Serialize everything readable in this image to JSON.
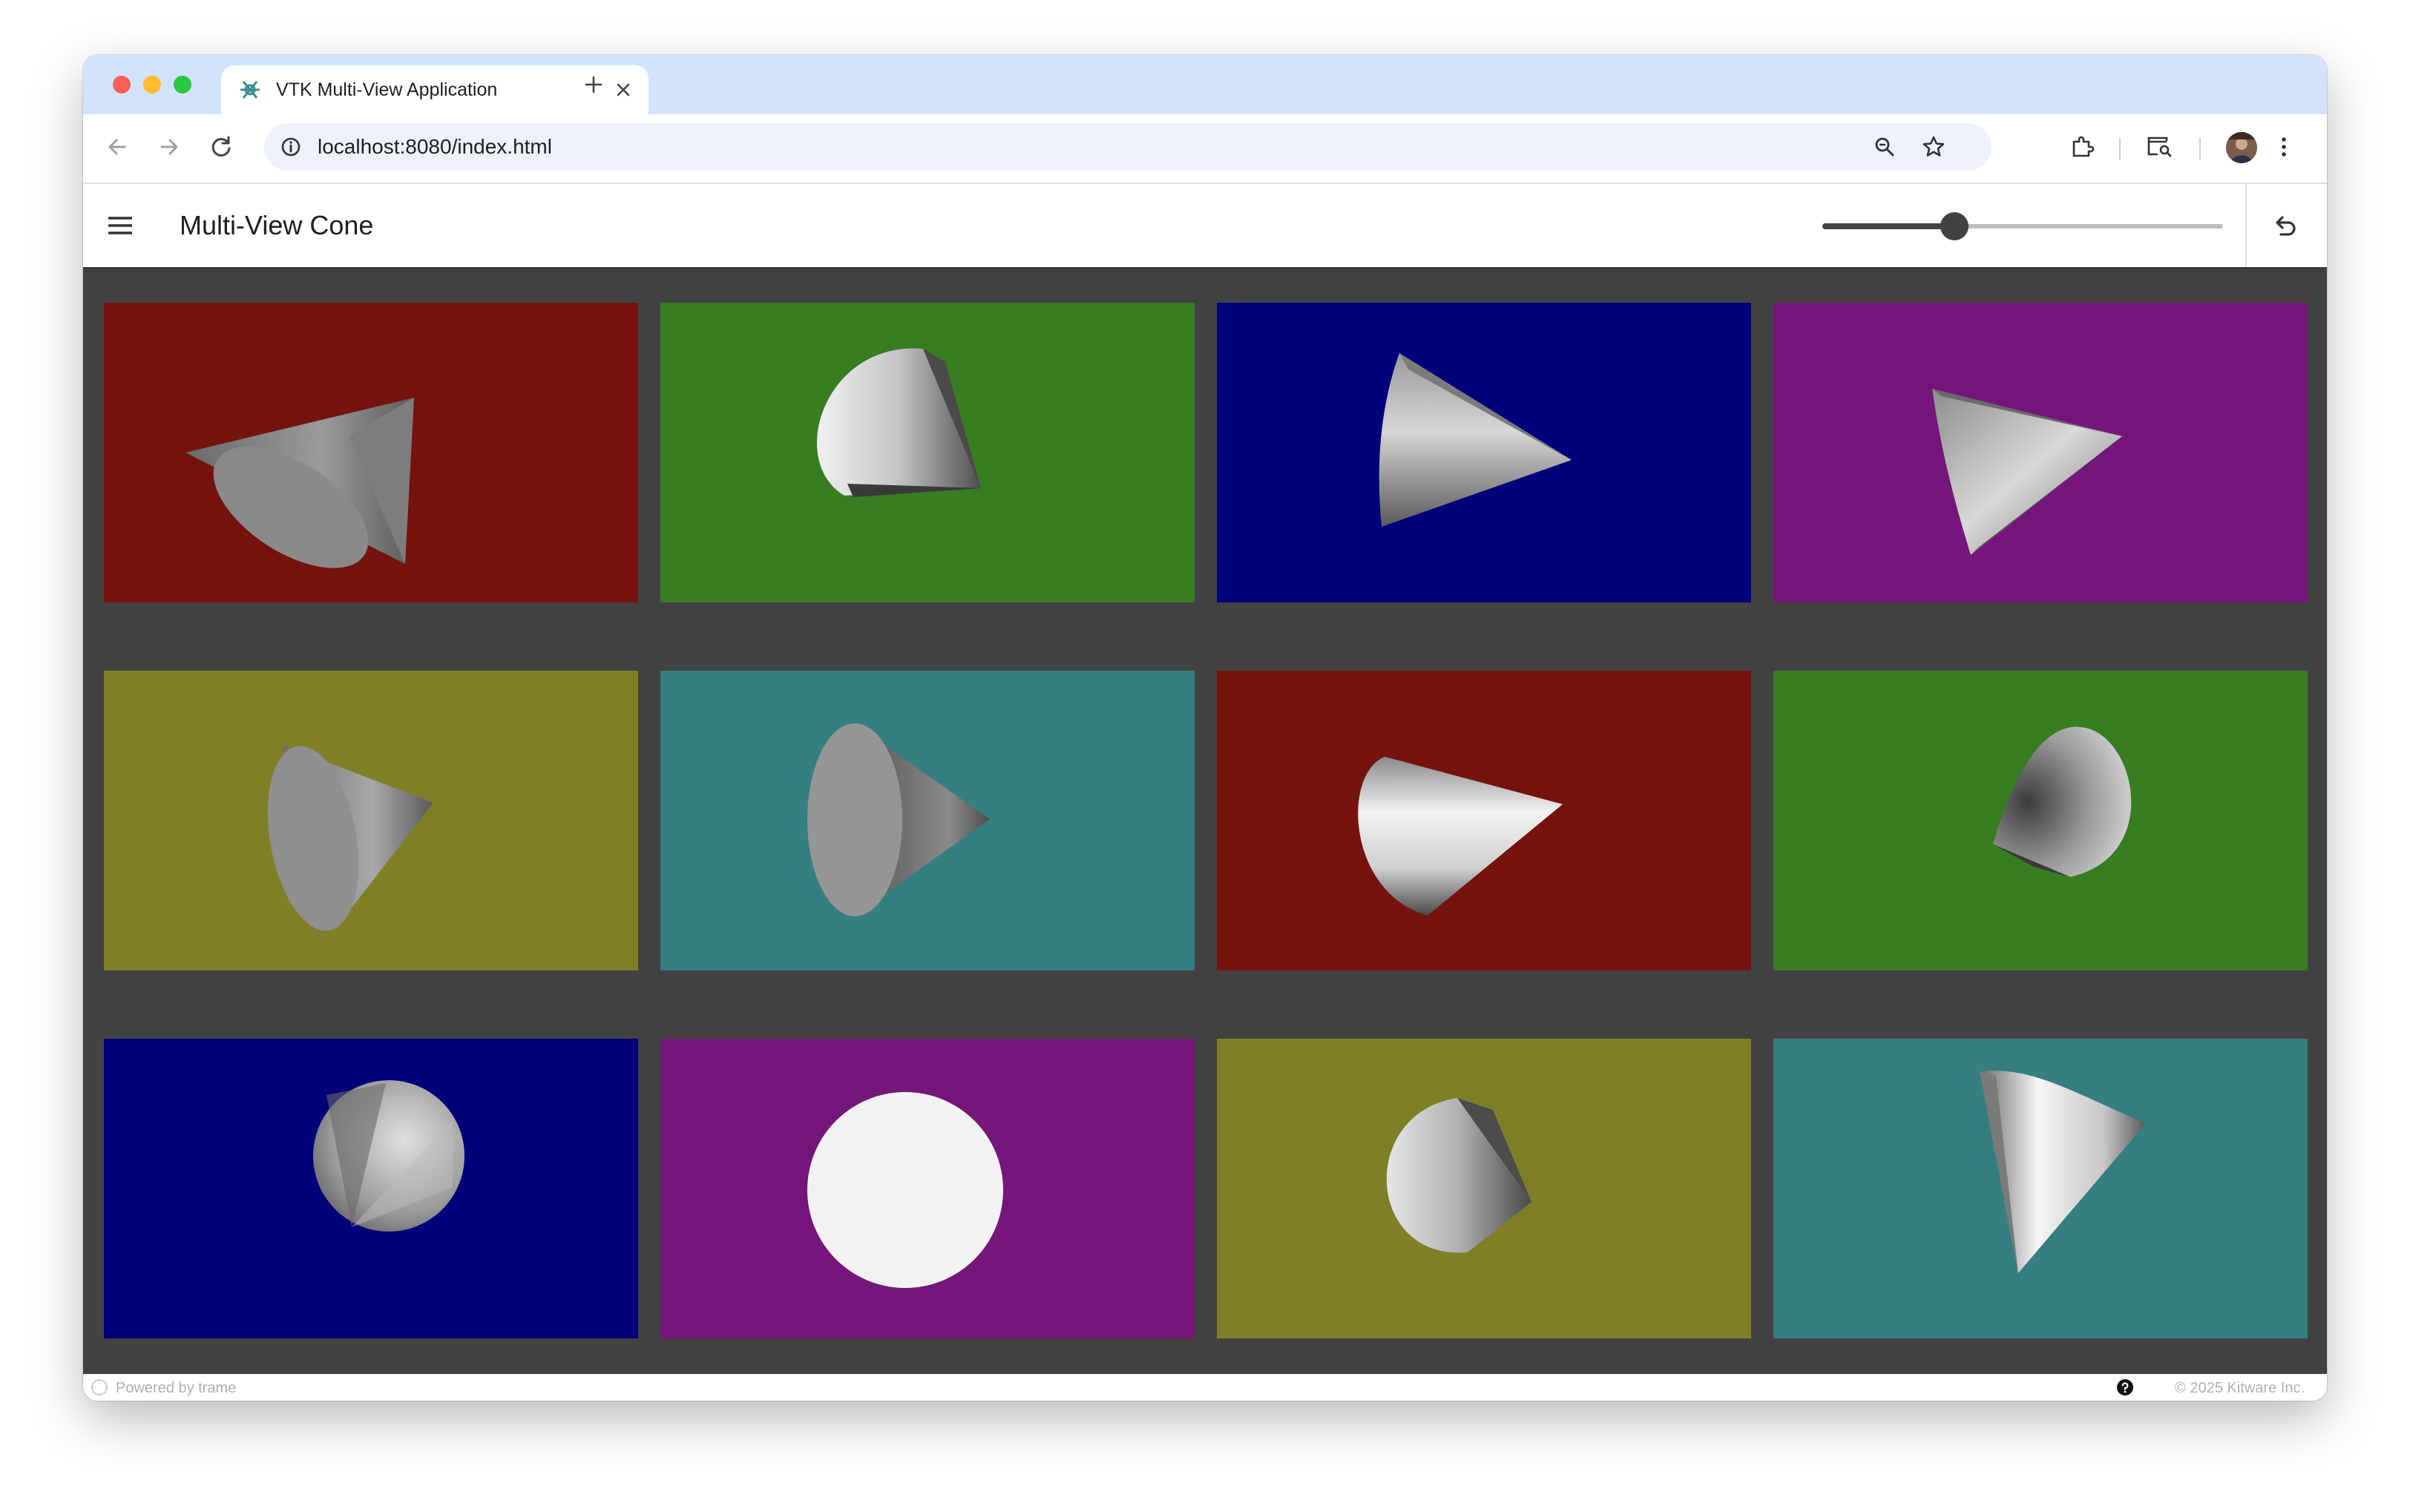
{
  "browser": {
    "tab_title": "VTK Multi-View Application",
    "url": "localhost:8080/index.html"
  },
  "app": {
    "title": "Multi-View Cone",
    "resolution_slider": {
      "value": 0.33
    }
  },
  "views": [
    {
      "background": "#75130e",
      "cone_color": "gray"
    },
    {
      "background": "#377d22",
      "cone_color": "gray"
    },
    {
      "background": "#00007b",
      "cone_color": "gray"
    },
    {
      "background": "#75167a",
      "cone_color": "gray"
    },
    {
      "background": "#7f7f27",
      "cone_color": "gray"
    },
    {
      "background": "#367f80",
      "cone_color": "gray"
    },
    {
      "background": "#75130e",
      "cone_color": "gray"
    },
    {
      "background": "#377d22",
      "cone_color": "gray"
    },
    {
      "background": "#00007b",
      "cone_color": "gray"
    },
    {
      "background": "#75167a",
      "cone_color": "white"
    },
    {
      "background": "#7f7f27",
      "cone_color": "gray"
    },
    {
      "background": "#367f80",
      "cone_color": "gray"
    }
  ],
  "footer": {
    "powered_by": "Powered by trame",
    "copyright": "© 2025 Kitware Inc."
  },
  "icons": {
    "menu": "hamburger-menu-icon",
    "reset": "undo-reset-icon",
    "help": "question-circle-icon"
  }
}
